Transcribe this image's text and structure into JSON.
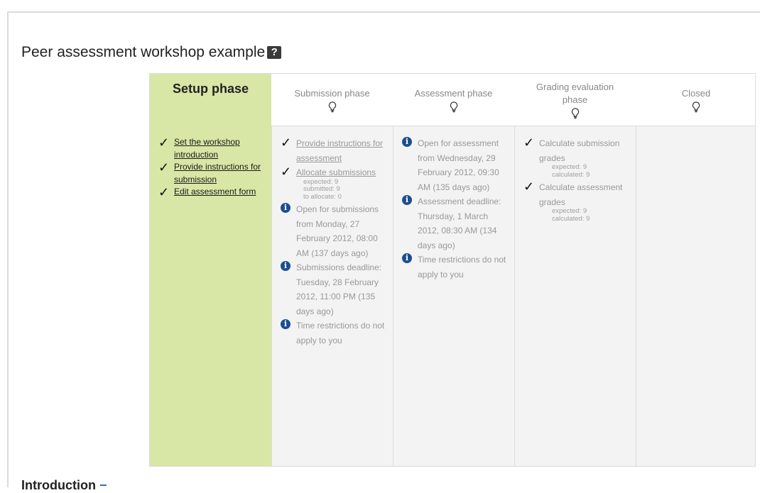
{
  "workshop": {
    "title": "Peer assessment workshop example",
    "help_icon": "?"
  },
  "phases": [
    {
      "name": "Setup phase",
      "active": true,
      "tasks": [
        {
          "status": "done",
          "icon": "check-icon",
          "text": "Set the workshop introduction",
          "link": true,
          "details": []
        },
        {
          "status": "done",
          "icon": "check-icon",
          "text": "Provide instructions for submission",
          "link": true,
          "details": []
        },
        {
          "status": "done",
          "icon": "check-icon",
          "text": "Edit assessment form",
          "link": true,
          "details": []
        }
      ]
    },
    {
      "name": "Submission phase",
      "active": false,
      "tasks": [
        {
          "status": "done",
          "icon": "check-icon",
          "text": "Provide instructions for assessment",
          "link": true,
          "details": []
        },
        {
          "status": "done",
          "icon": "check-icon",
          "text": "Allocate submissions",
          "link": true,
          "details": [
            "expected: 9",
            "submitted: 9",
            "to allocate: 0"
          ]
        },
        {
          "status": "info",
          "icon": "info-icon",
          "text": "Open for submissions from Monday, 27 February 2012, 08:00 AM (137 days ago)",
          "link": false,
          "details": []
        },
        {
          "status": "info",
          "icon": "info-icon",
          "text": "Submissions deadline: Tuesday, 28 February 2012, 11:00 PM (135 days ago)",
          "link": false,
          "details": []
        },
        {
          "status": "info",
          "icon": "info-icon",
          "text": "Time restrictions do not apply to you",
          "link": false,
          "details": []
        }
      ]
    },
    {
      "name": "Assessment phase",
      "active": false,
      "tasks": [
        {
          "status": "info",
          "icon": "info-icon",
          "text": "Open for assessment from Wednesday, 29 February 2012, 09:30 AM (135 days ago)",
          "link": false,
          "details": []
        },
        {
          "status": "info",
          "icon": "info-icon",
          "text": "Assessment deadline: Thursday, 1 March 2012, 08:30 AM (134 days ago)",
          "link": false,
          "details": []
        },
        {
          "status": "info",
          "icon": "info-icon",
          "text": "Time restrictions do not apply to you",
          "link": false,
          "details": []
        }
      ]
    },
    {
      "name": "Grading evaluation phase",
      "active": false,
      "tasks": [
        {
          "status": "done",
          "icon": "check-icon",
          "text": "Calculate submission grades",
          "link": false,
          "details": [
            "expected: 9",
            "calculated: 9"
          ]
        },
        {
          "status": "done",
          "icon": "check-icon",
          "text": "Calculate assessment grades",
          "link": false,
          "details": [
            "expected: 9",
            "calculated: 9"
          ]
        }
      ]
    },
    {
      "name": "Closed",
      "active": false,
      "tasks": []
    }
  ],
  "next_section": {
    "title": "Introduction",
    "toggle": "−"
  }
}
